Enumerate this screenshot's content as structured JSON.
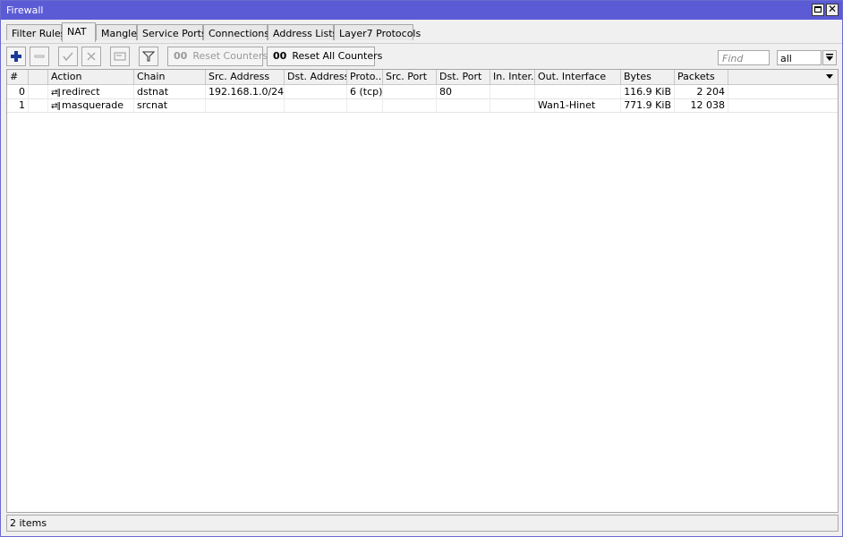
{
  "window": {
    "title": "Firewall"
  },
  "tabs": [
    "Filter Rules",
    "NAT",
    "Mangle",
    "Service Ports",
    "Connections",
    "Address Lists",
    "Layer7 Protocols"
  ],
  "active_tab": "NAT",
  "toolbar": {
    "reset_counters_label": "Reset Counters",
    "reset_all_counters_label": "Reset All Counters",
    "counter_glyph": "00",
    "find_placeholder": "Find",
    "filter_value": "all"
  },
  "table": {
    "columns": [
      "#",
      "",
      "Action",
      "Chain",
      "Src. Address",
      "Dst. Address",
      "Proto...",
      "Src. Port",
      "Dst. Port",
      "In. Inter...",
      "Out. Interface",
      "Bytes",
      "Packets"
    ],
    "rows": [
      {
        "num": "0",
        "action_icon": "⇄‖",
        "action": "redirect",
        "chain": "dstnat",
        "src_address": "192.168.1.0/24",
        "dst_address": "",
        "protocol": "6 (tcp)",
        "src_port": "",
        "dst_port": "80",
        "in_interface": "",
        "out_interface": "",
        "bytes": "116.9 KiB",
        "packets": "2 204"
      },
      {
        "num": "1",
        "action_icon": "⇄‖",
        "action": "masquerade",
        "chain": "srcnat",
        "src_address": "",
        "dst_address": "",
        "protocol": "",
        "src_port": "",
        "dst_port": "",
        "in_interface": "",
        "out_interface": "Wan1-Hinet",
        "bytes": "771.9 KiB",
        "packets": "12 038"
      }
    ]
  },
  "status": {
    "text": "2 items"
  },
  "colors": {
    "titlebar": "#5b5bd6",
    "add_icon": "#1a3a9a"
  }
}
